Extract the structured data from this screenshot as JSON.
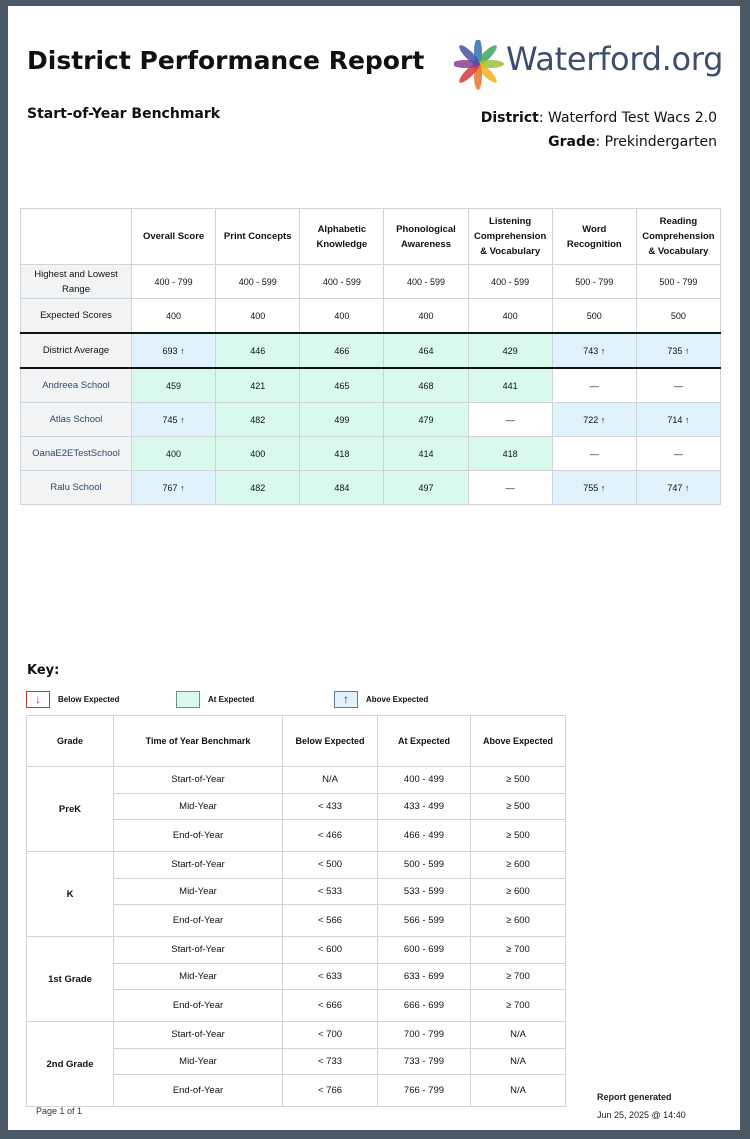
{
  "header": {
    "title": "District Performance Report",
    "logo_text": "Waterford.org",
    "subtitle": "Start-of-Year Benchmark",
    "district_label": "District",
    "district_value": ": Waterford Test Wacs 2.0",
    "grade_label": "Grade",
    "grade_value": ": Prekindergarten"
  },
  "performance": {
    "columns": [
      "Overall Score",
      "Print Concepts",
      "Alphabetic Knowledge",
      "Phonological Awareness",
      "Listening Comprehension & Vocabulary",
      "Word Recognition",
      "Reading Comprehension & Vocabulary"
    ],
    "range_label": "Highest and Lowest Range",
    "ranges": [
      "400 - 799",
      "400 - 599",
      "400 - 599",
      "400 - 599",
      "400 - 599",
      "500 - 799",
      "500 - 799"
    ],
    "expected_label": "Expected Scores",
    "expected": [
      "400",
      "400",
      "400",
      "400",
      "400",
      "500",
      "500"
    ],
    "district": {
      "label": "District Average",
      "values": [
        "693 ↑",
        "446",
        "466",
        "464",
        "429",
        "743 ↑",
        "735 ↑"
      ],
      "status": [
        "above",
        "at",
        "at",
        "at",
        "at",
        "above",
        "above"
      ]
    },
    "schools": [
      {
        "name": "Andreea School",
        "values": [
          "459",
          "421",
          "465",
          "468",
          "441",
          "—",
          "—"
        ],
        "status": [
          "at",
          "at",
          "at",
          "at",
          "at",
          "none",
          "none"
        ]
      },
      {
        "name": "Atlas School",
        "values": [
          "745 ↑",
          "482",
          "499",
          "479",
          "—",
          "722 ↑",
          "714 ↑"
        ],
        "status": [
          "above",
          "at",
          "at",
          "at",
          "none",
          "above",
          "above"
        ]
      },
      {
        "name": "OanaE2ETestSchool",
        "values": [
          "400",
          "400",
          "418",
          "414",
          "418",
          "—",
          "—"
        ],
        "status": [
          "at",
          "at",
          "at",
          "at",
          "at",
          "none",
          "none"
        ]
      },
      {
        "name": "Ralu School",
        "values": [
          "767 ↑",
          "482",
          "484",
          "497",
          "—",
          "755 ↑",
          "747 ↑"
        ],
        "status": [
          "above",
          "at",
          "at",
          "at",
          "none",
          "above",
          "above"
        ]
      }
    ]
  },
  "key": {
    "title": "Key:",
    "legend": {
      "below": "Below Expected",
      "below_glyph": "↓",
      "at": "At Expected",
      "above": "Above Expected",
      "above_glyph": "↑"
    },
    "headers": [
      "Grade",
      "Time of Year Benchmark",
      "Below Expected",
      "At Expected",
      "Above Expected"
    ],
    "groups": [
      {
        "grade": "PreK",
        "rows": [
          [
            "Start-of-Year",
            "N/A",
            "400 - 499",
            "≥ 500"
          ],
          [
            "Mid-Year",
            "< 433",
            "433 - 499",
            "≥ 500"
          ],
          [
            "End-of-Year",
            "< 466",
            "466 - 499",
            "≥ 500"
          ]
        ]
      },
      {
        "grade": "K",
        "rows": [
          [
            "Start-of-Year",
            "< 500",
            "500 - 599",
            "≥ 600"
          ],
          [
            "Mid-Year",
            "< 533",
            "533 - 599",
            "≥ 600"
          ],
          [
            "End-of-Year",
            "< 566",
            "566 - 599",
            "≥ 600"
          ]
        ]
      },
      {
        "grade": "1st Grade",
        "rows": [
          [
            "Start-of-Year",
            "< 600",
            "600 - 699",
            "≥ 700"
          ],
          [
            "Mid-Year",
            "< 633",
            "633 - 699",
            "≥ 700"
          ],
          [
            "End-of-Year",
            "< 666",
            "666 - 699",
            "≥ 700"
          ]
        ]
      },
      {
        "grade": "2nd Grade",
        "rows": [
          [
            "Start-of-Year",
            "< 700",
            "700 - 799",
            "N/A"
          ],
          [
            "Mid-Year",
            "< 733",
            "733 - 799",
            "N/A"
          ],
          [
            "End-of-Year",
            "< 766",
            "766 - 799",
            "N/A"
          ]
        ]
      }
    ]
  },
  "footer": {
    "page": "Page 1 of 1",
    "generated_label": "Report generated",
    "generated_value": "Jun 25, 2025 @ 14:40"
  },
  "colors": {
    "at_expected": "#d8f9ec",
    "above_expected": "#e0f2fc",
    "below_expected_border": "#c0392b",
    "school_link": "#2c4a6e",
    "logo_text": "#3c4d6e"
  }
}
